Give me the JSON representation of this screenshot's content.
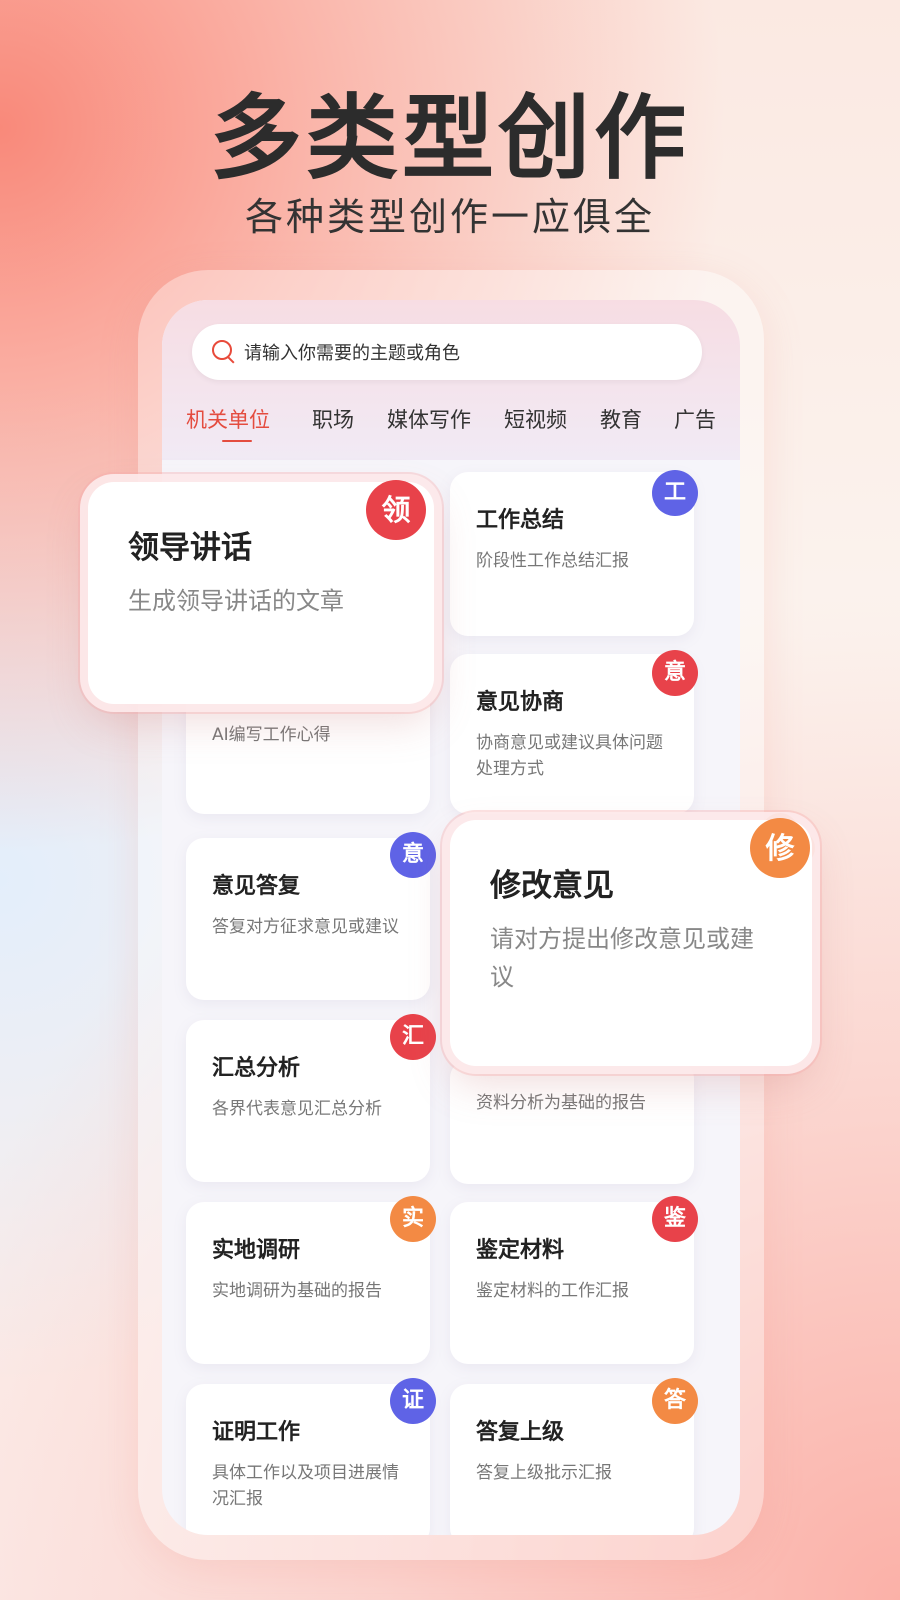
{
  "hero": {
    "title": "多类型创作",
    "subtitle": "各种类型创作一应俱全"
  },
  "search": {
    "placeholder": "请输入你需要的主题或角色"
  },
  "tabs": [
    {
      "label": "机关单位",
      "active": true
    },
    {
      "label": "职场"
    },
    {
      "label": "媒体写作"
    },
    {
      "label": "短视频"
    },
    {
      "label": "教育"
    },
    {
      "label": "广告"
    }
  ],
  "cards": {
    "c1": {
      "title": "工作总结",
      "desc": "阶段性工作总结汇报",
      "badge": "工",
      "badge_color": "blue"
    },
    "c2_partial": {
      "desc": "AI编写工作心得"
    },
    "c3": {
      "title": "意见协商",
      "desc": "协商意见或建议具体问题处理方式",
      "badge": "意",
      "badge_color": "red"
    },
    "c4": {
      "title": "意见答复",
      "desc": "答复对方征求意见或建议",
      "badge": "意",
      "badge_color": "blue"
    },
    "c5": {
      "title": "汇总分析",
      "desc": "各界代表意见汇总分析",
      "badge": "汇",
      "badge_color": "red"
    },
    "c6_partial": {
      "desc": "资料分析为基础的报告"
    },
    "c7": {
      "title": "实地调研",
      "desc": "实地调研为基础的报告",
      "badge": "实",
      "badge_color": "orange"
    },
    "c8": {
      "title": "鉴定材料",
      "desc": "鉴定材料的工作汇报",
      "badge": "鉴",
      "badge_color": "red"
    },
    "c9": {
      "title": "证明工作",
      "desc": "具体工作以及项目进展情况汇报",
      "badge": "证",
      "badge_color": "blue"
    },
    "c10": {
      "title": "答复上级",
      "desc": "答复上级批示汇报",
      "badge": "答",
      "badge_color": "orange"
    }
  },
  "featured": {
    "leader": {
      "title": "领导讲话",
      "desc": "生成领导讲话的文章",
      "badge": "领",
      "badge_color": "red"
    },
    "revise": {
      "title": "修改意见",
      "desc": "请对方提出修改意见或建议",
      "badge": "修",
      "badge_color": "orange"
    }
  },
  "colors": {
    "accent": "#e44c3f",
    "badge_red": "#e8424a",
    "badge_blue": "#5f63e6",
    "badge_orange": "#f38a44"
  }
}
